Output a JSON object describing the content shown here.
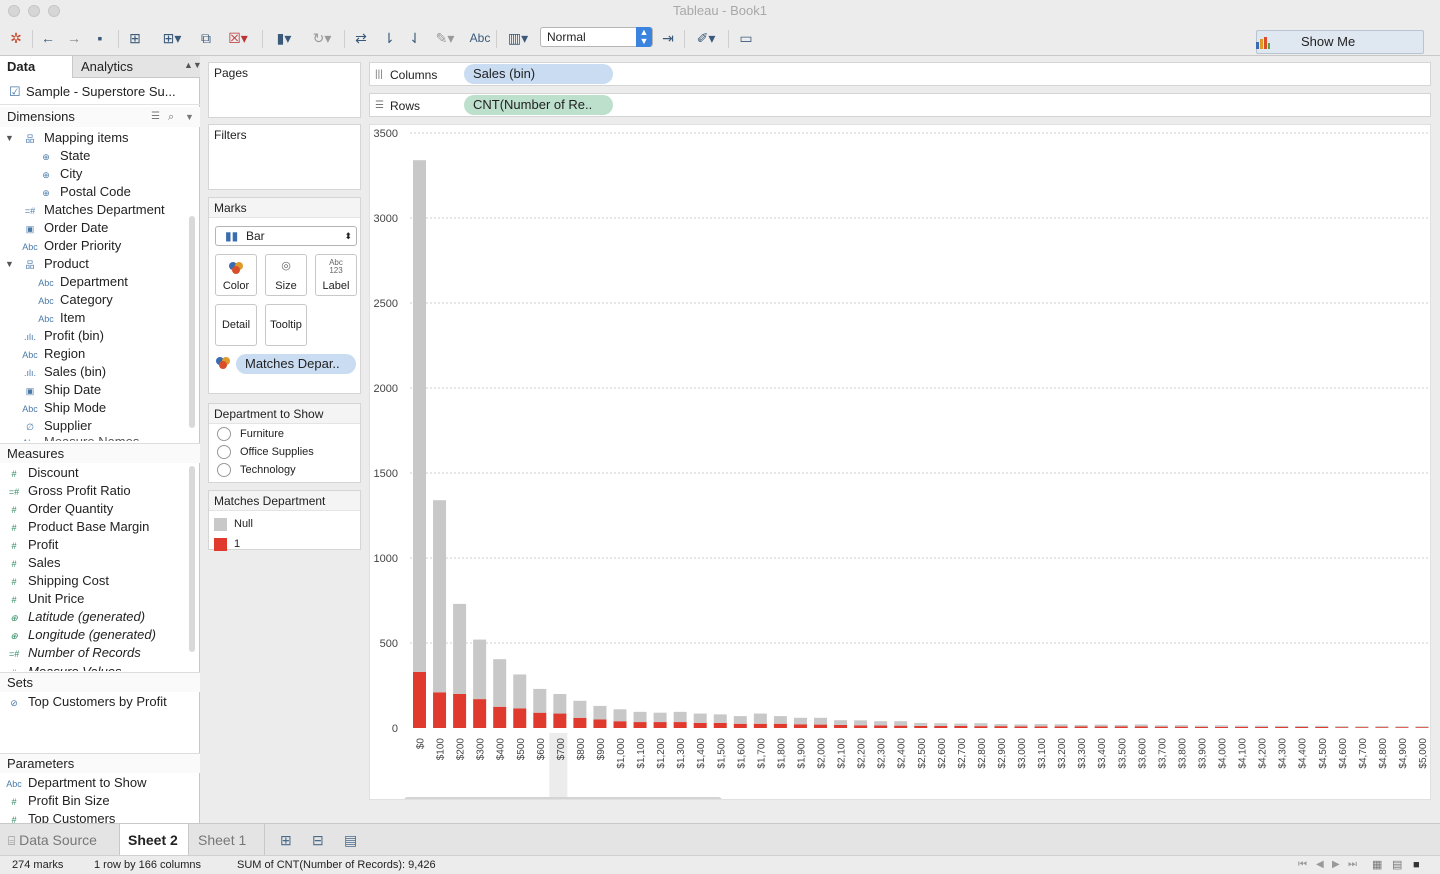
{
  "window": {
    "title": "Tableau - Book1"
  },
  "toolbar": {
    "text_label": "Abc",
    "view_select": "Normal",
    "show_me": "Show Me"
  },
  "data_pane": {
    "tabs": [
      "Data",
      "Analytics"
    ],
    "data_source": "Sample - Superstore Su...",
    "dimensions_header": "Dimensions",
    "dimensions": [
      {
        "label": "Mapping items",
        "icon": "hierarchy-icon",
        "glyph": "品",
        "indent": 1,
        "expanded": true
      },
      {
        "label": "State",
        "icon": "globe-icon",
        "glyph": "⊕",
        "indent": 2
      },
      {
        "label": "City",
        "icon": "globe-icon",
        "glyph": "⊕",
        "indent": 2
      },
      {
        "label": "Postal Code",
        "icon": "globe-icon",
        "glyph": "⊕",
        "indent": 2
      },
      {
        "label": "Matches Department",
        "icon": "calc-number-icon",
        "glyph": "=#",
        "indent": 1
      },
      {
        "label": "Order Date",
        "icon": "calendar-icon",
        "glyph": "▣",
        "indent": 1
      },
      {
        "label": "Order Priority",
        "icon": "abc-icon",
        "glyph": "Abc",
        "indent": 1
      },
      {
        "label": "Product",
        "icon": "hierarchy-icon",
        "glyph": "品",
        "indent": 1,
        "expanded": true
      },
      {
        "label": "Department",
        "icon": "abc-icon",
        "glyph": "Abc",
        "indent": 2
      },
      {
        "label": "Category",
        "icon": "abc-icon",
        "glyph": "Abc",
        "indent": 2
      },
      {
        "label": "Item",
        "icon": "abc-icon",
        "glyph": "Abc",
        "indent": 2
      },
      {
        "label": "Profit (bin)",
        "icon": "bin-icon",
        "glyph": ".ılı.",
        "indent": 1
      },
      {
        "label": "Region",
        "icon": "abc-icon",
        "glyph": "Abc",
        "indent": 1
      },
      {
        "label": "Sales (bin)",
        "icon": "bin-icon",
        "glyph": ".ılı.",
        "indent": 1
      },
      {
        "label": "Ship Date",
        "icon": "calendar-icon",
        "glyph": "▣",
        "indent": 1
      },
      {
        "label": "Ship Mode",
        "icon": "abc-icon",
        "glyph": "Abc",
        "indent": 1
      },
      {
        "label": "Supplier",
        "icon": "paperclip-icon",
        "glyph": "∅",
        "indent": 1
      }
    ],
    "measures_header": "Measures",
    "measures": [
      {
        "label": "Discount",
        "icon": "number-icon",
        "glyph": "#"
      },
      {
        "label": "Gross Profit Ratio",
        "icon": "calc-number-icon",
        "glyph": "=#"
      },
      {
        "label": "Order Quantity",
        "icon": "number-icon",
        "glyph": "#"
      },
      {
        "label": "Product Base Margin",
        "icon": "number-icon",
        "glyph": "#"
      },
      {
        "label": "Profit",
        "icon": "number-icon",
        "glyph": "#"
      },
      {
        "label": "Sales",
        "icon": "number-icon",
        "glyph": "#"
      },
      {
        "label": "Shipping Cost",
        "icon": "number-icon",
        "glyph": "#"
      },
      {
        "label": "Unit Price",
        "icon": "number-icon",
        "glyph": "#"
      },
      {
        "label": "Latitude (generated)",
        "icon": "globe-icon",
        "glyph": "⊕",
        "italic": true
      },
      {
        "label": "Longitude (generated)",
        "icon": "globe-icon",
        "glyph": "⊕",
        "italic": true
      },
      {
        "label": "Number of Records",
        "icon": "calc-number-icon",
        "glyph": "=#",
        "italic": true
      }
    ],
    "sets_header": "Sets",
    "sets": [
      {
        "label": "Top Customers by Profit",
        "icon": "set-icon",
        "glyph": "⊘"
      }
    ],
    "parameters_header": "Parameters",
    "parameters": [
      {
        "label": "Department to Show",
        "icon": "abc-icon",
        "glyph": "Abc"
      },
      {
        "label": "Profit Bin Size",
        "icon": "number-icon",
        "glyph": "#"
      },
      {
        "label": "Top Customers",
        "icon": "number-icon",
        "glyph": "#"
      }
    ]
  },
  "cards": {
    "pages": "Pages",
    "filters": "Filters",
    "marks": "Marks",
    "mark_type": "Bar",
    "mark_buttons": [
      "Color",
      "Size",
      "Label",
      "Detail",
      "Tooltip"
    ],
    "color_pill": "Matches Depar..",
    "dept_title": "Department to Show",
    "dept_options": [
      "Furniture",
      "Office Supplies",
      "Technology"
    ],
    "legend_title": "Matches Department",
    "legend_items": [
      {
        "label": "Null",
        "color": "#c8c8c8"
      },
      {
        "label": "1",
        "color": "#e03a2f"
      }
    ]
  },
  "shelves": {
    "columns_label": "Columns",
    "columns_pill": "Sales (bin)",
    "rows_label": "Rows",
    "rows_pill": "CNT(Number of Re.."
  },
  "chart_data": {
    "type": "bar",
    "stacked": true,
    "ylim": [
      0,
      3500
    ],
    "yticks": [
      0,
      500,
      1000,
      1500,
      2000,
      2500,
      3000,
      3500
    ],
    "categories": [
      "$0",
      "$100",
      "$200",
      "$300",
      "$400",
      "$500",
      "$600",
      "$700",
      "$800",
      "$900",
      "$1,000",
      "$1,100",
      "$1,200",
      "$1,300",
      "$1,400",
      "$1,500",
      "$1,600",
      "$1,700",
      "$1,800",
      "$1,900",
      "$2,000",
      "$2,100",
      "$2,200",
      "$2,300",
      "$2,400",
      "$2,500",
      "$2,600",
      "$2,700",
      "$2,800",
      "$2,900",
      "$3,000",
      "$3,100",
      "$3,200",
      "$3,300",
      "$3,400",
      "$3,500",
      "$3,600",
      "$3,700",
      "$3,800",
      "$3,900",
      "$4,000",
      "$4,100",
      "$4,200",
      "$4,300",
      "$4,400",
      "$4,500",
      "$4,600",
      "$4,700",
      "$4,800",
      "$4,900",
      "$5,000"
    ],
    "series": [
      {
        "name": "1",
        "color": "#e03a2f",
        "values": [
          330,
          210,
          200,
          170,
          125,
          115,
          90,
          85,
          60,
          50,
          40,
          35,
          35,
          35,
          30,
          30,
          25,
          25,
          25,
          22,
          20,
          18,
          16,
          15,
          14,
          12,
          12,
          12,
          11,
          11,
          10,
          10,
          10,
          9,
          9,
          9,
          9,
          8,
          8,
          7,
          7,
          7,
          6,
          6,
          6,
          6,
          5,
          5,
          5,
          5,
          5
        ]
      },
      {
        "name": "Null",
        "color": "#c8c8c8",
        "values": [
          3010,
          1130,
          530,
          350,
          280,
          200,
          140,
          115,
          100,
          80,
          70,
          60,
          55,
          60,
          55,
          50,
          45,
          60,
          45,
          38,
          40,
          28,
          29,
          25,
          26,
          18,
          16,
          14,
          17,
          12,
          11,
          13,
          12,
          9,
          11,
          9,
          12,
          8,
          9,
          7,
          9,
          7,
          8,
          7,
          6,
          7,
          6,
          5,
          6,
          5,
          5
        ]
      }
    ]
  },
  "bottom": {
    "tabs": [
      "Data Source",
      "Sheet 2",
      "Sheet 1"
    ],
    "status": [
      "274 marks",
      "1 row by 166 columns",
      "SUM of CNT(Number of Records): 9,426"
    ]
  }
}
